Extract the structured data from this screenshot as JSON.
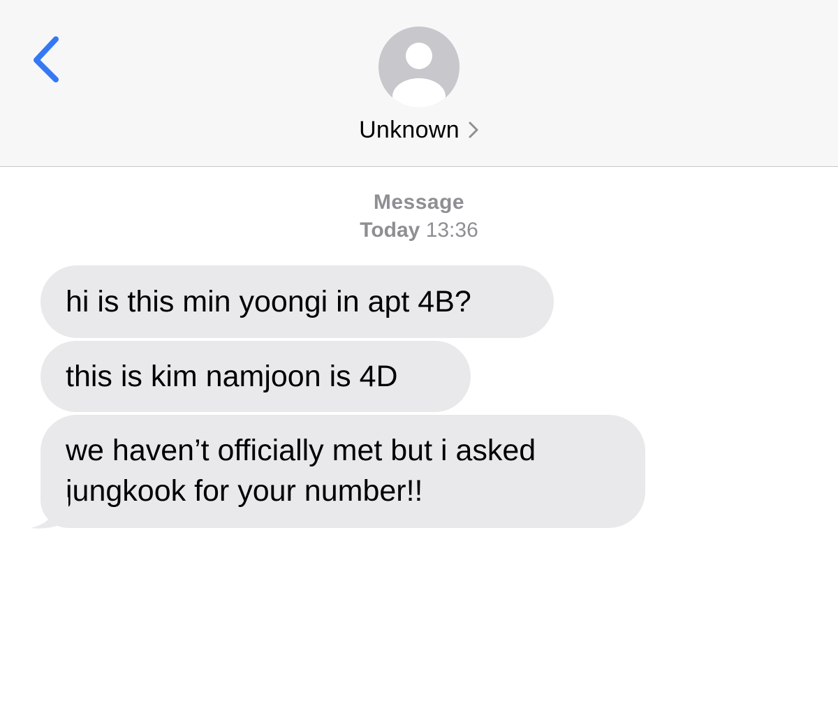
{
  "header": {
    "back_icon": "chevron-left-icon",
    "avatar_icon": "person-icon",
    "contact_name": "Unknown",
    "contact_chevron_icon": "chevron-right-icon",
    "accent_color": "#3478f6"
  },
  "thread": {
    "service": "Message",
    "day": "Today",
    "time": "13:36",
    "messages": [
      {
        "line1": "hi is this min yoongi in apt 4B?"
      },
      {
        "line1": "this is kim namjoon is 4D"
      },
      {
        "line1": "we haven’t officially met but i asked",
        "line2": "jungkook for your number!!"
      }
    ],
    "bubble_color": "#e9e9eb"
  }
}
